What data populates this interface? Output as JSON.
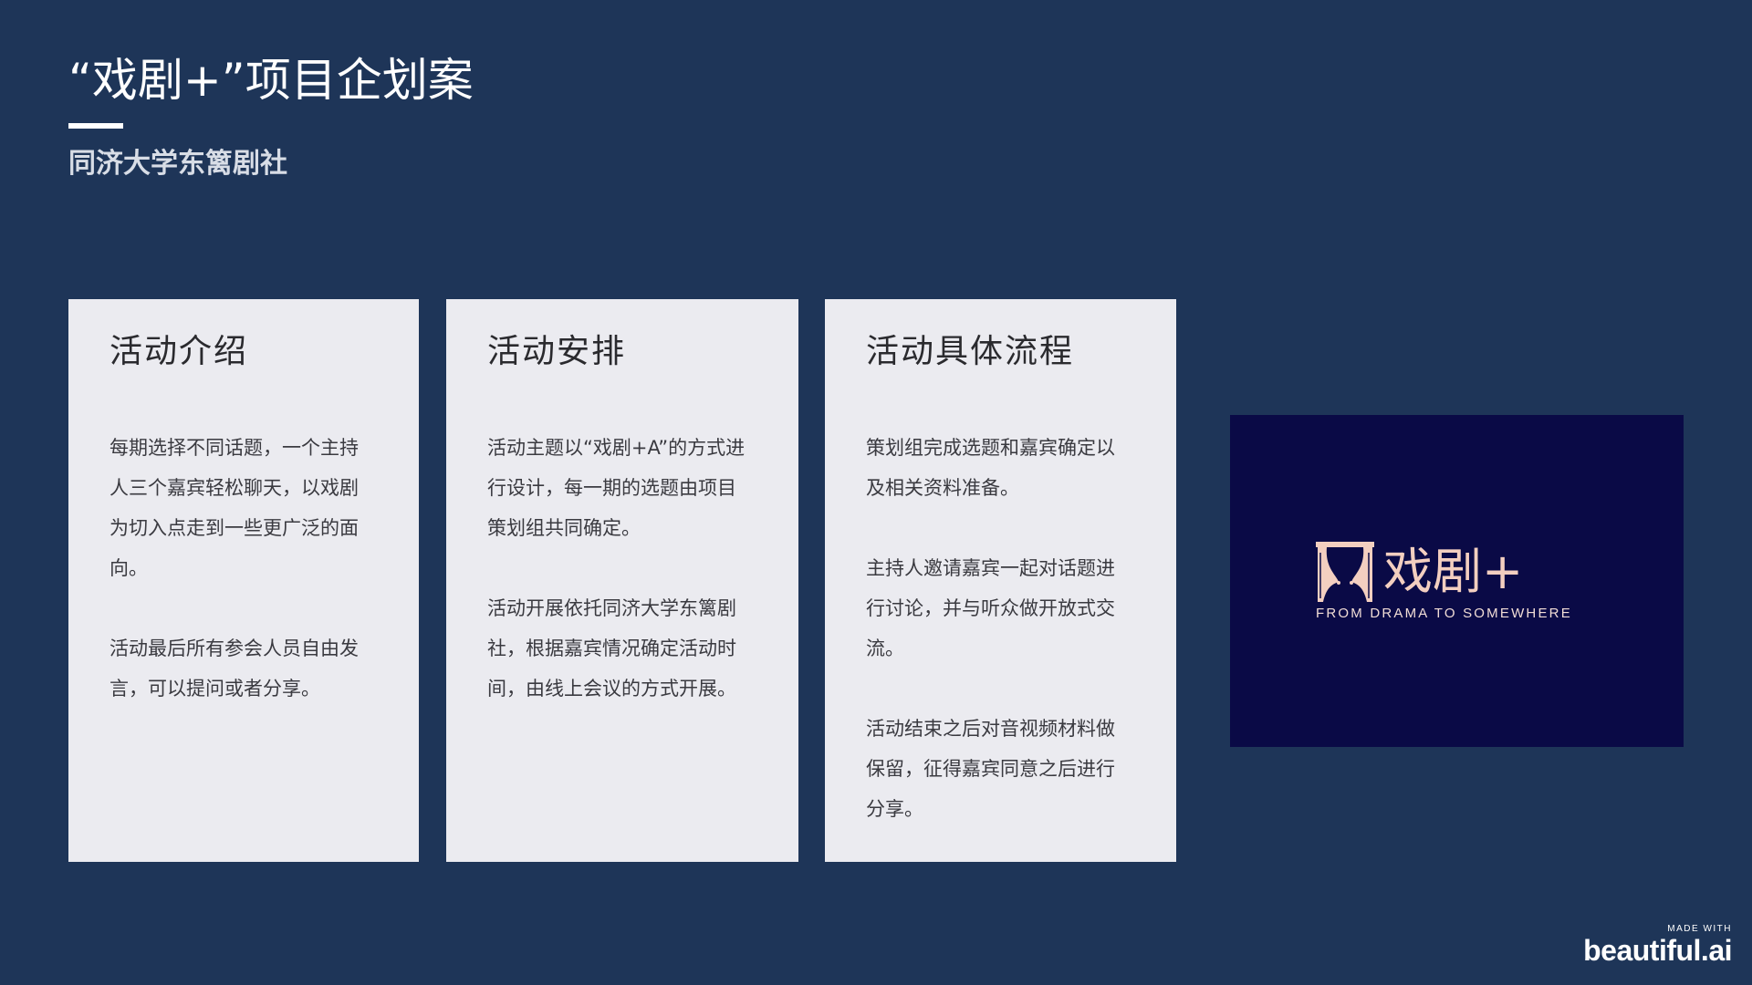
{
  "header": {
    "title": "“戏剧+”项目企划案",
    "subtitle": "同济大学东篱剧社"
  },
  "cards": [
    {
      "title": "活动介绍",
      "paragraphs": [
        "每期选择不同话题，一个主持人三个嘉宾轻松聊天，以戏剧为切入点走到一些更广泛的面向。",
        "活动最后所有参会人员自由发言，可以提问或者分享。"
      ]
    },
    {
      "title": "活动安排",
      "paragraphs": [
        "活动主题以“戏剧+A”的方式进行设计，每一期的选题由项目策划组共同确定。",
        "活动开展依托同济大学东篱剧社，根据嘉宾情况确定活动时间，由线上会议的方式开展。"
      ]
    },
    {
      "title": "活动具体流程",
      "paragraphs": [
        "策划组完成选题和嘉宾确定以及相关资料准备。",
        "主持人邀请嘉宾一起对话题进行讨论，并与听众做开放式交流。",
        "活动结束之后对音视频材料做保留，征得嘉宾同意之后进行分享。"
      ]
    }
  ],
  "logo": {
    "icon": "curtain-icon",
    "text": "戏剧+",
    "tagline": "FROM DRAMA TO SOMEWHERE",
    "colors": {
      "background": "#0a0a46",
      "foreground": "#f3cfc0"
    }
  },
  "footer": {
    "made_with": "MADE WITH",
    "brand": "beautiful.ai"
  },
  "colors": {
    "page_background": "#1e3558",
    "card_background": "#ebebf0"
  }
}
